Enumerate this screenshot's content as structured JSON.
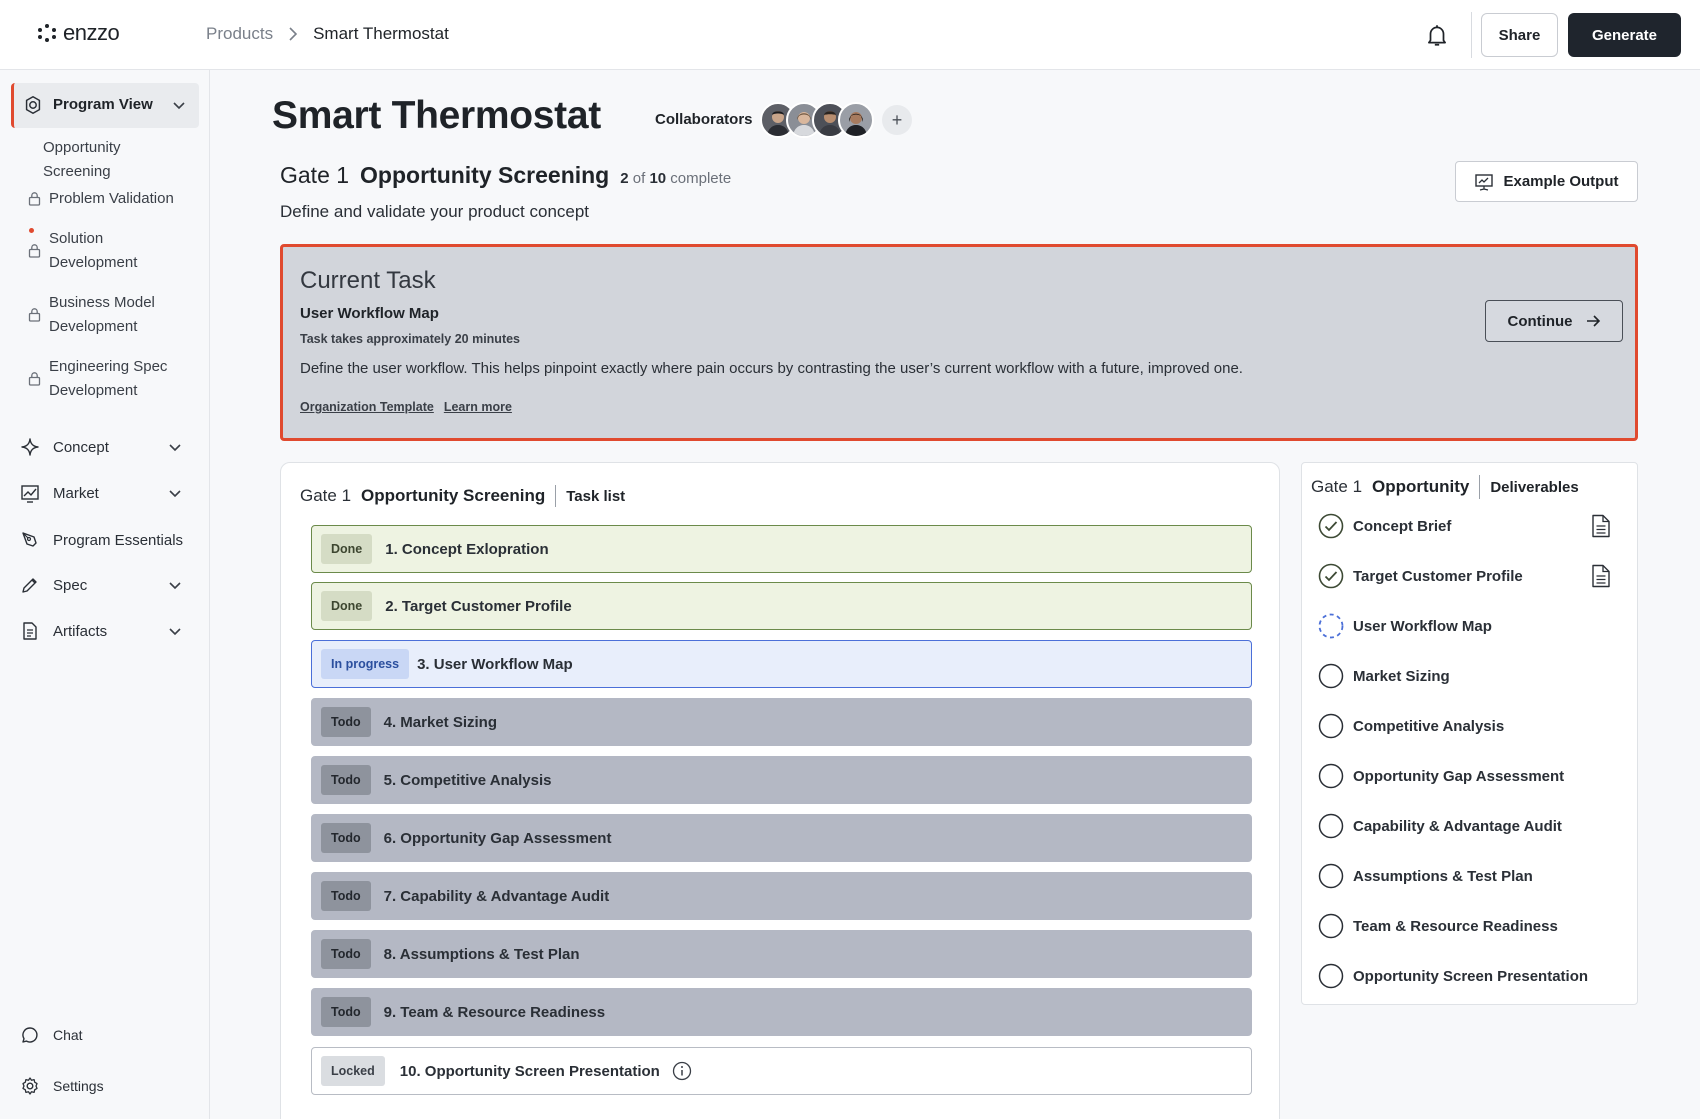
{
  "header": {
    "logo_text": "enzzo",
    "breadcrumb": {
      "parent": "Products",
      "current": "Smart Thermostat"
    },
    "share_label": "Share",
    "generate_label": "Generate"
  },
  "sidebar": {
    "program_view": "Program View",
    "gate_items": [
      {
        "label": "Opportunity Screening",
        "state": "active"
      },
      {
        "label": "Problem Validation",
        "state": "locked"
      },
      {
        "label": "Solution Development",
        "state": "locked"
      },
      {
        "label": "Business Model Development",
        "state": "locked"
      },
      {
        "label": "Engineering Spec Development",
        "state": "locked"
      }
    ],
    "nav": [
      {
        "label": "Concept",
        "icon": "sparkle-icon",
        "expandable": true
      },
      {
        "label": "Market",
        "icon": "chart-icon",
        "expandable": true
      },
      {
        "label": "Program Essentials",
        "icon": "pen-tool-icon",
        "expandable": false
      },
      {
        "label": "Spec",
        "icon": "pencil-icon",
        "expandable": true
      },
      {
        "label": "Artifacts",
        "icon": "document-icon",
        "expandable": true
      }
    ],
    "chat_label": "Chat",
    "settings_label": "Settings"
  },
  "page": {
    "title": "Smart Thermostat",
    "collaborators_label": "Collaborators",
    "collaborator_count": 4,
    "add_collaborator": "+",
    "gate_label": "Gate 1",
    "gate_name": "Opportunity Screening",
    "progress_done": "2",
    "progress_of": "of",
    "progress_total": "10",
    "progress_suffix": "complete",
    "gate_description": "Define and validate your product concept",
    "example_output_label": "Example Output"
  },
  "current_task": {
    "heading": "Current Task",
    "name": "User Workflow Map",
    "duration": "Task takes approximately 20 minutes",
    "description": "Define the user workflow. This helps pinpoint exactly where pain occurs by contrasting the user’s current workflow with a future, improved one.",
    "links": [
      "Organization Template",
      "Learn more"
    ],
    "continue_label": "Continue"
  },
  "task_list": {
    "gate_label": "Gate 1",
    "gate_name": "Opportunity Screening",
    "tab_label": "Task list",
    "tasks": [
      {
        "status": "Done",
        "name": "1. Concept Exlopration"
      },
      {
        "status": "Done",
        "name": "2. Target Customer Profile"
      },
      {
        "status": "In progress",
        "name": "3. User Workflow Map"
      },
      {
        "status": "Todo",
        "name": "4. Market Sizing"
      },
      {
        "status": "Todo",
        "name": "5. Competitive Analysis"
      },
      {
        "status": "Todo",
        "name": "6. Opportunity Gap Assessment"
      },
      {
        "status": "Todo",
        "name": "7. Capability & Advantage Audit"
      },
      {
        "status": "Todo",
        "name": "8. Assumptions & Test Plan"
      },
      {
        "status": "Todo",
        "name": "9. Team & Resource Readiness"
      },
      {
        "status": "Locked",
        "name": "10. Opportunity Screen Presentation"
      }
    ]
  },
  "deliverables": {
    "gate_label": "Gate 1",
    "gate_name": "Opportunity",
    "tab_label": "Deliverables",
    "items": [
      {
        "name": "Concept Brief",
        "state": "complete"
      },
      {
        "name": "Target Customer Profile",
        "state": "complete"
      },
      {
        "name": "User Workflow Map",
        "state": "in-progress"
      },
      {
        "name": "Market Sizing",
        "state": "todo"
      },
      {
        "name": "Competitive Analysis",
        "state": "todo"
      },
      {
        "name": "Opportunity Gap Assessment",
        "state": "todo"
      },
      {
        "name": "Capability & Advantage Audit",
        "state": "todo"
      },
      {
        "name": "Assumptions & Test Plan",
        "state": "todo"
      },
      {
        "name": "Team & Resource Readiness",
        "state": "todo"
      },
      {
        "name": "Opportunity Screen Presentation",
        "state": "todo"
      }
    ]
  },
  "colors": {
    "accent": "#e04a2f",
    "done_border": "#6b8a4a",
    "progress_border": "#4b6fd8",
    "todo_bg": "#b4b8c4",
    "primary_button": "#1f252d"
  }
}
